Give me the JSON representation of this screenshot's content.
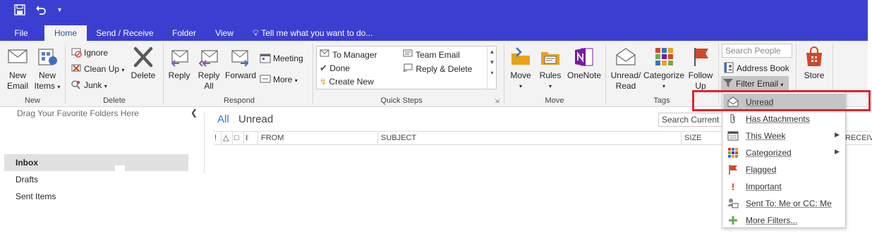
{
  "quick_access": {
    "save_icon": "save-icon",
    "undo_icon": "undo-icon",
    "customize_icon": "customize-qat-icon"
  },
  "tabs": [
    {
      "label": "File"
    },
    {
      "label": "Home"
    },
    {
      "label": "Send / Receive"
    },
    {
      "label": "Folder"
    },
    {
      "label": "View"
    }
  ],
  "tell_me": "Tell me what you want to do...",
  "ribbon": {
    "new": {
      "group_label": "New",
      "new_email": "New\nEmail",
      "new_email_l1": "New",
      "new_email_l2": "Email",
      "new_items_l1": "New",
      "new_items_l2": "Items"
    },
    "delete": {
      "group_label": "Delete",
      "ignore": "Ignore",
      "clean_up": "Clean Up",
      "junk": "Junk",
      "delete": "Delete"
    },
    "respond": {
      "group_label": "Respond",
      "reply": "Reply",
      "reply_all_l1": "Reply",
      "reply_all_l2": "All",
      "forward": "Forward",
      "meeting": "Meeting",
      "more": "More"
    },
    "quick_steps": {
      "group_label": "Quick Steps",
      "items": [
        "To Manager",
        "Team Email",
        "Done",
        "Reply & Delete",
        "Create New"
      ]
    },
    "move": {
      "group_label": "Move",
      "move": "Move",
      "rules": "Rules",
      "onenote": "OneNote"
    },
    "tags": {
      "group_label": "Tags",
      "unread_read_l1": "Unread/",
      "unread_read_l2": "Read",
      "categorize": "Categorize",
      "follow_up_l1": "Follow",
      "follow_up_l2": "Up"
    },
    "find": {
      "search_people_placeholder": "Search People",
      "address_book": "Address Book",
      "filter_email": "Filter Email"
    },
    "store": {
      "store": "Store"
    }
  },
  "folder_pane": {
    "favorites_hint": "Drag Your Favorite Folders Here",
    "folders": [
      "Inbox",
      "Drafts",
      "Sent Items"
    ]
  },
  "message_list": {
    "filter_all": "All",
    "filter_unread": "Unread",
    "search_placeholder": "Search Current M",
    "columns": [
      "!",
      "FROM",
      "SUBJECT",
      "SIZE",
      "RECEIVE"
    ]
  },
  "filter_menu": {
    "items": [
      {
        "label": "Unread",
        "icon": "envelope-open-icon"
      },
      {
        "label": "Has Attachments",
        "icon": "paperclip-icon"
      },
      {
        "label": "This Week",
        "icon": "calendar-icon"
      },
      {
        "label": "Categorized",
        "icon": "category-grid-icon"
      },
      {
        "label": "Flagged",
        "icon": "flag-icon"
      },
      {
        "label": "Important",
        "icon": "exclamation-icon"
      },
      {
        "label": "Sent To: Me or CC: Me",
        "icon": "sent-to-me-icon"
      },
      {
        "label": "More Filters...",
        "icon": "plus-icon"
      }
    ]
  },
  "colors": {
    "title_bar": "#3b3fd1",
    "accent_blue": "#2b7cd3",
    "highlight_red": "#e8202a"
  }
}
